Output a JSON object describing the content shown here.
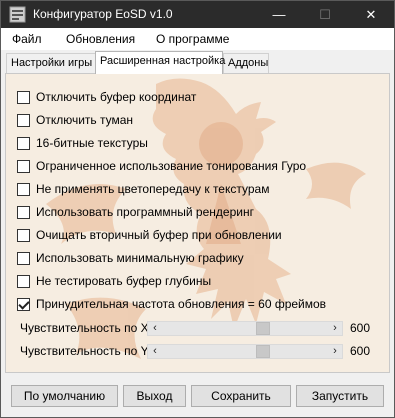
{
  "window": {
    "title": "Конфигуратор EoSD v1.0",
    "minimize_glyph": "—",
    "maximize_glyph": "☐",
    "close_glyph": "✕"
  },
  "menu": {
    "items": [
      {
        "label": "Файл"
      },
      {
        "label": "Обновления"
      },
      {
        "label": "О программе"
      }
    ]
  },
  "tabs": [
    {
      "label": "Настройки игры",
      "active": false
    },
    {
      "label": "Расширенная настройка",
      "active": true
    },
    {
      "label": "Аддоны",
      "active": false
    }
  ],
  "options": [
    {
      "label": "Отключить буфер координат",
      "checked": false
    },
    {
      "label": "Отключить туман",
      "checked": false
    },
    {
      "label": "16-битные текстуры",
      "checked": false
    },
    {
      "label": "Ограниченное использование тонирования Гуро",
      "checked": false
    },
    {
      "label": "Не применять цветопередачу к текстурам",
      "checked": false
    },
    {
      "label": "Использовать программный рендеринг",
      "checked": false
    },
    {
      "label": "Очищать вторичный буфер при обновлении",
      "checked": false
    },
    {
      "label": "Использовать минимальную графику",
      "checked": false
    },
    {
      "label": "Не тестировать буфер глубины",
      "checked": false
    },
    {
      "label": "Принудительная частота обновления = 60 фреймов",
      "checked": true
    }
  ],
  "sliders": [
    {
      "label": "Чувствительность по X",
      "value": "600",
      "level": 0.62
    },
    {
      "label": "Чувствительность по Y",
      "value": "600",
      "level": 0.62
    }
  ],
  "buttons": {
    "defaults": "По умолчанию",
    "exit": "Выход",
    "save": "Сохранить",
    "launch": "Запустить"
  },
  "colors": {
    "titlebar": "#2b2b2b",
    "panel_background": "#f6ede1",
    "art_tint": "#e7b48f"
  },
  "icons": {
    "app": "app-icon",
    "slider_left": "arrow-left-icon",
    "slider_right": "arrow-right-icon"
  }
}
